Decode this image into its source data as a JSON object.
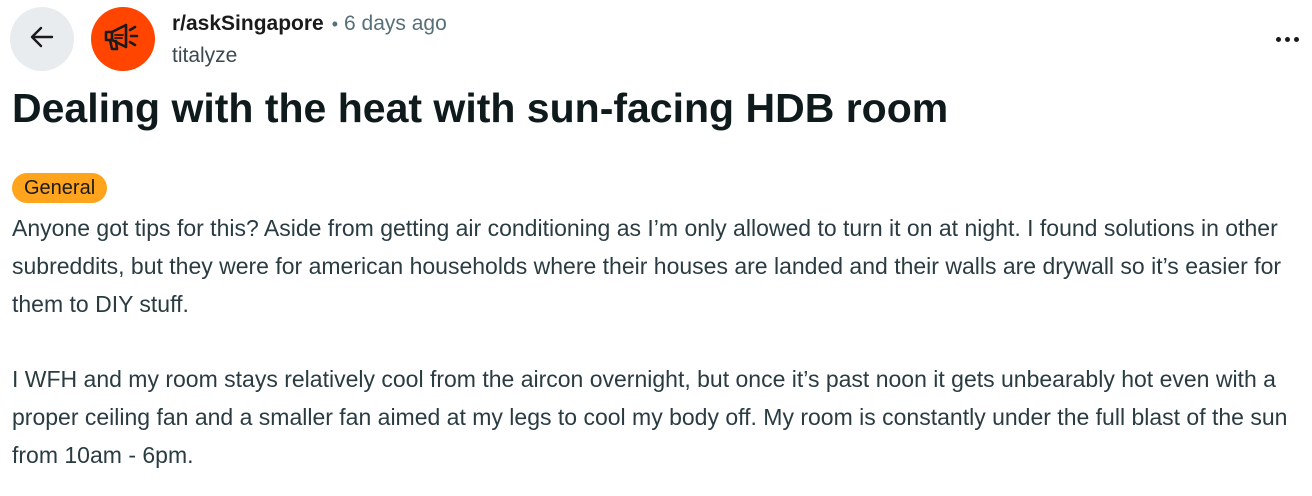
{
  "header": {
    "subreddit": "r/askSingapore",
    "separator": "•",
    "time_ago": "6 days ago",
    "author": "titalyze",
    "back_icon": "arrow-left-icon",
    "avatar_icon": "megaphone-icon",
    "more_icon": "more-horizontal-icon"
  },
  "post": {
    "title": "Dealing with the heat with sun-facing HDB room",
    "flair": "General",
    "paragraphs": [
      "Anyone got tips for this? Aside from getting air conditioning as I’m only allowed to turn it on at night. I found solutions in other subreddits, but they were for american households where their houses are landed and their walls are drywall so it’s easier for them to DIY stuff.",
      "I WFH and my room stays relatively cool from the aircon overnight, but once it’s past noon it gets unbearably hot even with a proper ceiling fan and a smaller fan aimed at my legs to cool my body off. My room is constantly under the full blast of the sun from 10am - 6pm."
    ]
  },
  "colors": {
    "avatar_bg": "#ff4500",
    "flair_bg": "#ffa41c",
    "back_button_bg": "#e9ecef"
  }
}
